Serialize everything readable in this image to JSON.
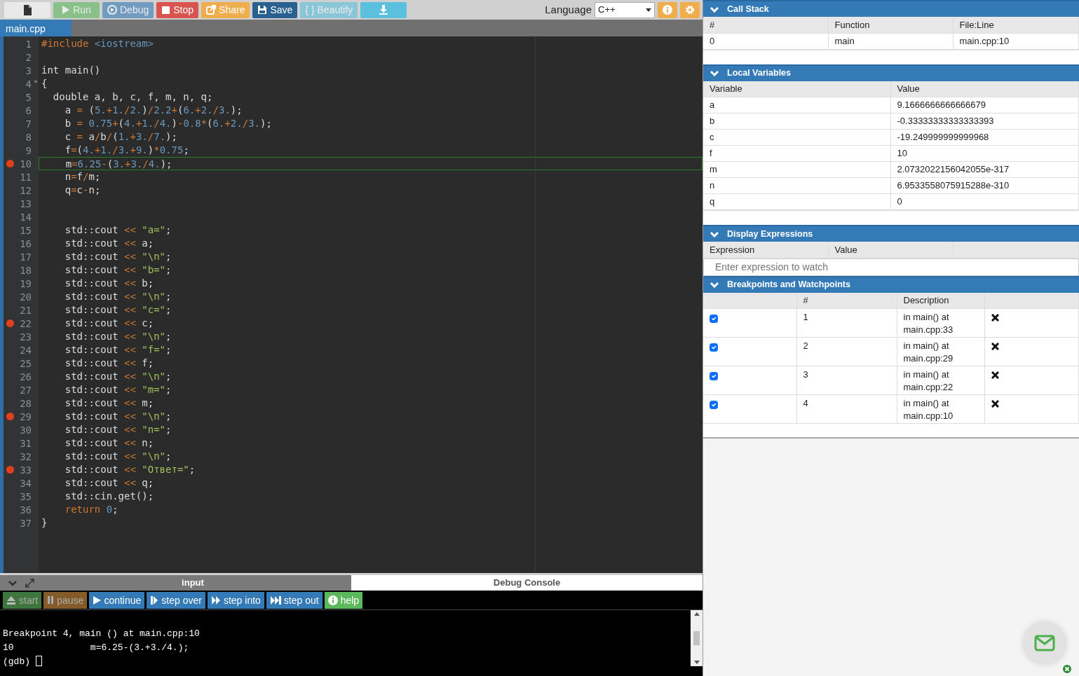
{
  "toolbar": {
    "buttons": [
      {
        "kind": "new",
        "disabled": false
      },
      {
        "kind": "run",
        "label": "Run",
        "disabled": true
      },
      {
        "kind": "debug",
        "label": "Debug",
        "disabled": true
      },
      {
        "kind": "stop",
        "label": "Stop",
        "disabled": false
      },
      {
        "kind": "share",
        "label": "Share",
        "disabled": false
      },
      {
        "kind": "save",
        "label": "Save",
        "disabled": false
      },
      {
        "kind": "beautify",
        "label": "{ } Beautify",
        "disabled": true
      },
      {
        "kind": "download",
        "disabled": false
      }
    ],
    "language_label": "Language",
    "language": "C++",
    "icon_buttons": [
      {
        "kind": "info"
      },
      {
        "kind": "settings"
      }
    ]
  },
  "file_tabs": [
    {
      "label": "main.cpp",
      "selected": true
    }
  ],
  "editor": {
    "lines": [
      {
        "number": "1",
        "breakpoint": false,
        "current": false,
        "fold": false,
        "tokens": [
          {
            "kind": "kw",
            "text": "#include"
          },
          {
            "kind": "num",
            "text": " <iostream>"
          }
        ]
      },
      {
        "number": "2",
        "breakpoint": false,
        "current": false,
        "fold": false
      },
      {
        "number": "3",
        "breakpoint": false,
        "current": false,
        "fold": false,
        "tokens": [
          {
            "kind": "txt",
            "text": "int main()"
          }
        ]
      },
      {
        "number": "4",
        "breakpoint": false,
        "current": false,
        "fold": true,
        "tokens": [
          {
            "kind": "txt",
            "text": "{"
          }
        ]
      },
      {
        "number": "5",
        "breakpoint": false,
        "current": false,
        "fold": false,
        "tokens": [
          {
            "kind": "txt",
            "text": "  double a, b, c, f, m, n, q;"
          }
        ]
      },
      {
        "number": "6",
        "breakpoint": false,
        "current": false,
        "fold": false,
        "tokens": [
          {
            "kind": "txt",
            "text": "    a "
          },
          {
            "kind": "op",
            "text": "="
          },
          {
            "kind": "txt",
            "text": " ("
          },
          {
            "kind": "num",
            "text": "5."
          },
          {
            "kind": "op",
            "text": "+"
          },
          {
            "kind": "num",
            "text": "1."
          },
          {
            "kind": "op",
            "text": "/"
          },
          {
            "kind": "num",
            "text": "2."
          },
          {
            "kind": "txt",
            "text": ")"
          },
          {
            "kind": "op",
            "text": "/"
          },
          {
            "kind": "num",
            "text": "2.2"
          },
          {
            "kind": "op",
            "text": "+"
          },
          {
            "kind": "txt",
            "text": "("
          },
          {
            "kind": "num",
            "text": "6."
          },
          {
            "kind": "op",
            "text": "+"
          },
          {
            "kind": "num",
            "text": "2."
          },
          {
            "kind": "op",
            "text": "/"
          },
          {
            "kind": "num",
            "text": "3."
          },
          {
            "kind": "txt",
            "text": ");"
          }
        ]
      },
      {
        "number": "7",
        "breakpoint": false,
        "current": false,
        "fold": false,
        "tokens": [
          {
            "kind": "txt",
            "text": "    b "
          },
          {
            "kind": "op",
            "text": "="
          },
          {
            "kind": "num",
            "text": " 0.75"
          },
          {
            "kind": "op",
            "text": "+"
          },
          {
            "kind": "txt",
            "text": "("
          },
          {
            "kind": "num",
            "text": "4."
          },
          {
            "kind": "op",
            "text": "+"
          },
          {
            "kind": "num",
            "text": "1."
          },
          {
            "kind": "op",
            "text": "/"
          },
          {
            "kind": "num",
            "text": "4."
          },
          {
            "kind": "txt",
            "text": ")"
          },
          {
            "kind": "op",
            "text": "-"
          },
          {
            "kind": "num",
            "text": "0.8"
          },
          {
            "kind": "op",
            "text": "*"
          },
          {
            "kind": "txt",
            "text": "("
          },
          {
            "kind": "num",
            "text": "6."
          },
          {
            "kind": "op",
            "text": "+"
          },
          {
            "kind": "num",
            "text": "2."
          },
          {
            "kind": "op",
            "text": "/"
          },
          {
            "kind": "num",
            "text": "3."
          },
          {
            "kind": "txt",
            "text": ");"
          }
        ]
      },
      {
        "number": "8",
        "breakpoint": false,
        "current": false,
        "fold": false,
        "tokens": [
          {
            "kind": "txt",
            "text": "    c "
          },
          {
            "kind": "op",
            "text": "="
          },
          {
            "kind": "txt",
            "text": " a"
          },
          {
            "kind": "op",
            "text": "/"
          },
          {
            "kind": "txt",
            "text": "b"
          },
          {
            "kind": "op",
            "text": "/"
          },
          {
            "kind": "txt",
            "text": "("
          },
          {
            "kind": "num",
            "text": "1."
          },
          {
            "kind": "op",
            "text": "+"
          },
          {
            "kind": "num",
            "text": "3."
          },
          {
            "kind": "op",
            "text": "/"
          },
          {
            "kind": "num",
            "text": "7."
          },
          {
            "kind": "txt",
            "text": ");"
          }
        ]
      },
      {
        "number": "9",
        "breakpoint": false,
        "current": false,
        "fold": false,
        "tokens": [
          {
            "kind": "txt",
            "text": "    f"
          },
          {
            "kind": "op",
            "text": "="
          },
          {
            "kind": "txt",
            "text": "("
          },
          {
            "kind": "num",
            "text": "4."
          },
          {
            "kind": "op",
            "text": "+"
          },
          {
            "kind": "num",
            "text": "1."
          },
          {
            "kind": "op",
            "text": "/"
          },
          {
            "kind": "num",
            "text": "3."
          },
          {
            "kind": "op",
            "text": "+"
          },
          {
            "kind": "num",
            "text": "9."
          },
          {
            "kind": "txt",
            "text": ")"
          },
          {
            "kind": "op",
            "text": "*"
          },
          {
            "kind": "num",
            "text": "0.75"
          },
          {
            "kind": "txt",
            "text": ";"
          }
        ]
      },
      {
        "number": "10",
        "breakpoint": true,
        "current": true,
        "fold": false,
        "tokens": [
          {
            "kind": "txt",
            "text": "    m"
          },
          {
            "kind": "op",
            "text": "="
          },
          {
            "kind": "num",
            "text": "6.25"
          },
          {
            "kind": "op",
            "text": "-"
          },
          {
            "kind": "txt",
            "text": "("
          },
          {
            "kind": "num",
            "text": "3."
          },
          {
            "kind": "op",
            "text": "+"
          },
          {
            "kind": "num",
            "text": "3."
          },
          {
            "kind": "op",
            "text": "/"
          },
          {
            "kind": "num",
            "text": "4."
          },
          {
            "kind": "txt",
            "text": ");"
          }
        ]
      },
      {
        "number": "11",
        "breakpoint": false,
        "current": false,
        "fold": false,
        "tokens": [
          {
            "kind": "txt",
            "text": "    n"
          },
          {
            "kind": "op",
            "text": "="
          },
          {
            "kind": "txt",
            "text": "f"
          },
          {
            "kind": "op",
            "text": "/"
          },
          {
            "kind": "txt",
            "text": "m;"
          }
        ]
      },
      {
        "number": "12",
        "breakpoint": false,
        "current": false,
        "fold": false,
        "tokens": [
          {
            "kind": "txt",
            "text": "    q"
          },
          {
            "kind": "op",
            "text": "="
          },
          {
            "kind": "txt",
            "text": "c"
          },
          {
            "kind": "op",
            "text": "-"
          },
          {
            "kind": "txt",
            "text": "n;"
          }
        ]
      },
      {
        "number": "13",
        "breakpoint": false,
        "current": false,
        "fold": false
      },
      {
        "number": "14",
        "breakpoint": false,
        "current": false,
        "fold": false
      },
      {
        "number": "15",
        "breakpoint": false,
        "current": false,
        "fold": false,
        "tokens": [
          {
            "kind": "txt",
            "text": "    std::cout "
          },
          {
            "kind": "op",
            "text": "<<"
          },
          {
            "kind": "str",
            "text": " \"a=\""
          },
          {
            "kind": "txt",
            "text": ";"
          }
        ]
      },
      {
        "number": "16",
        "breakpoint": false,
        "current": false,
        "fold": false,
        "tokens": [
          {
            "kind": "txt",
            "text": "    std::cout "
          },
          {
            "kind": "op",
            "text": "<<"
          },
          {
            "kind": "txt",
            "text": " a;"
          }
        ]
      },
      {
        "number": "17",
        "breakpoint": false,
        "current": false,
        "fold": false,
        "tokens": [
          {
            "kind": "txt",
            "text": "    std::cout "
          },
          {
            "kind": "op",
            "text": "<<"
          },
          {
            "kind": "str",
            "text": " \"\\n\""
          },
          {
            "kind": "txt",
            "text": ";"
          }
        ]
      },
      {
        "number": "18",
        "breakpoint": false,
        "current": false,
        "fold": false,
        "tokens": [
          {
            "kind": "txt",
            "text": "    std::cout "
          },
          {
            "kind": "op",
            "text": "<<"
          },
          {
            "kind": "str",
            "text": " \"b=\""
          },
          {
            "kind": "txt",
            "text": ";"
          }
        ]
      },
      {
        "number": "19",
        "breakpoint": false,
        "current": false,
        "fold": false,
        "tokens": [
          {
            "kind": "txt",
            "text": "    std::cout "
          },
          {
            "kind": "op",
            "text": "<<"
          },
          {
            "kind": "txt",
            "text": " b;"
          }
        ]
      },
      {
        "number": "20",
        "breakpoint": false,
        "current": false,
        "fold": false,
        "tokens": [
          {
            "kind": "txt",
            "text": "    std::cout "
          },
          {
            "kind": "op",
            "text": "<<"
          },
          {
            "kind": "str",
            "text": " \"\\n\""
          },
          {
            "kind": "txt",
            "text": ";"
          }
        ]
      },
      {
        "number": "21",
        "breakpoint": false,
        "current": false,
        "fold": false,
        "tokens": [
          {
            "kind": "txt",
            "text": "    std::cout "
          },
          {
            "kind": "op",
            "text": "<<"
          },
          {
            "kind": "str",
            "text": " \"c=\""
          },
          {
            "kind": "txt",
            "text": ";"
          }
        ]
      },
      {
        "number": "22",
        "breakpoint": true,
        "current": false,
        "fold": false,
        "tokens": [
          {
            "kind": "txt",
            "text": "    std::cout "
          },
          {
            "kind": "op",
            "text": "<<"
          },
          {
            "kind": "txt",
            "text": " c;"
          }
        ]
      },
      {
        "number": "23",
        "breakpoint": false,
        "current": false,
        "fold": false,
        "tokens": [
          {
            "kind": "txt",
            "text": "    std::cout "
          },
          {
            "kind": "op",
            "text": "<<"
          },
          {
            "kind": "str",
            "text": " \"\\n\""
          },
          {
            "kind": "txt",
            "text": ";"
          }
        ]
      },
      {
        "number": "24",
        "breakpoint": false,
        "current": false,
        "fold": false,
        "tokens": [
          {
            "kind": "txt",
            "text": "    std::cout "
          },
          {
            "kind": "op",
            "text": "<<"
          },
          {
            "kind": "str",
            "text": " \"f=\""
          },
          {
            "kind": "txt",
            "text": ";"
          }
        ]
      },
      {
        "number": "25",
        "breakpoint": false,
        "current": false,
        "fold": false,
        "tokens": [
          {
            "kind": "txt",
            "text": "    std::cout "
          },
          {
            "kind": "op",
            "text": "<<"
          },
          {
            "kind": "txt",
            "text": " f;"
          }
        ]
      },
      {
        "number": "26",
        "breakpoint": false,
        "current": false,
        "fold": false,
        "tokens": [
          {
            "kind": "txt",
            "text": "    std::cout "
          },
          {
            "kind": "op",
            "text": "<<"
          },
          {
            "kind": "str",
            "text": " \"\\n\""
          },
          {
            "kind": "txt",
            "text": ";"
          }
        ]
      },
      {
        "number": "27",
        "breakpoint": false,
        "current": false,
        "fold": false,
        "tokens": [
          {
            "kind": "txt",
            "text": "    std::cout "
          },
          {
            "kind": "op",
            "text": "<<"
          },
          {
            "kind": "str",
            "text": " \"m=\""
          },
          {
            "kind": "txt",
            "text": ";"
          }
        ]
      },
      {
        "number": "28",
        "breakpoint": false,
        "current": false,
        "fold": false,
        "tokens": [
          {
            "kind": "txt",
            "text": "    std::cout "
          },
          {
            "kind": "op",
            "text": "<<"
          },
          {
            "kind": "txt",
            "text": " m;"
          }
        ]
      },
      {
        "number": "29",
        "breakpoint": true,
        "current": false,
        "fold": false,
        "tokens": [
          {
            "kind": "txt",
            "text": "    std::cout "
          },
          {
            "kind": "op",
            "text": "<<"
          },
          {
            "kind": "str",
            "text": " \"\\n\""
          },
          {
            "kind": "txt",
            "text": ";"
          }
        ]
      },
      {
        "number": "30",
        "breakpoint": false,
        "current": false,
        "fold": false,
        "tokens": [
          {
            "kind": "txt",
            "text": "    std::cout "
          },
          {
            "kind": "op",
            "text": "<<"
          },
          {
            "kind": "str",
            "text": " \"n=\""
          },
          {
            "kind": "txt",
            "text": ";"
          }
        ]
      },
      {
        "number": "31",
        "breakpoint": false,
        "current": false,
        "fold": false,
        "tokens": [
          {
            "kind": "txt",
            "text": "    std::cout "
          },
          {
            "kind": "op",
            "text": "<<"
          },
          {
            "kind": "txt",
            "text": " n;"
          }
        ]
      },
      {
        "number": "32",
        "breakpoint": false,
        "current": false,
        "fold": false,
        "tokens": [
          {
            "kind": "txt",
            "text": "    std::cout "
          },
          {
            "kind": "op",
            "text": "<<"
          },
          {
            "kind": "str",
            "text": " \"\\n\""
          },
          {
            "kind": "txt",
            "text": ";"
          }
        ]
      },
      {
        "number": "33",
        "breakpoint": true,
        "current": false,
        "fold": false,
        "tokens": [
          {
            "kind": "txt",
            "text": "    std::cout "
          },
          {
            "kind": "op",
            "text": "<<"
          },
          {
            "kind": "str",
            "text": " \"Ответ=\""
          },
          {
            "kind": "txt",
            "text": ";"
          }
        ]
      },
      {
        "number": "34",
        "breakpoint": false,
        "current": false,
        "fold": false,
        "tokens": [
          {
            "kind": "txt",
            "text": "    std::cout "
          },
          {
            "kind": "op",
            "text": "<<"
          },
          {
            "kind": "txt",
            "text": " q;"
          }
        ]
      },
      {
        "number": "35",
        "breakpoint": false,
        "current": false,
        "fold": false,
        "tokens": [
          {
            "kind": "txt",
            "text": "    std::cin.get();"
          }
        ]
      },
      {
        "number": "36",
        "breakpoint": false,
        "current": false,
        "fold": false,
        "tokens": [
          {
            "kind": "kw",
            "text": "    return"
          },
          {
            "kind": "num",
            "text": " 0"
          },
          {
            "kind": "txt",
            "text": ";"
          }
        ]
      },
      {
        "number": "37",
        "breakpoint": false,
        "current": false,
        "fold": false,
        "tokens": [
          {
            "kind": "txt",
            "text": "}"
          }
        ]
      }
    ]
  },
  "bottom_tabs": [
    {
      "label": "input",
      "selected": false
    },
    {
      "label": "Debug Console",
      "selected": true
    }
  ],
  "debug_buttons": [
    {
      "kind": "start",
      "label": "start",
      "disabled": true
    },
    {
      "kind": "pause",
      "label": "pause",
      "disabled": true
    },
    {
      "kind": "continue",
      "label": "continue",
      "disabled": false
    },
    {
      "kind": "step_over",
      "label": "step over",
      "disabled": false
    },
    {
      "kind": "step_into",
      "label": "step into",
      "disabled": false
    },
    {
      "kind": "step_out",
      "label": "step out",
      "disabled": false
    },
    {
      "kind": "help",
      "label": "help",
      "disabled": false
    }
  ],
  "console": {
    "lines": [
      "Breakpoint 4, main () at main.cpp:10",
      "10\t\tm=6.25-(3.+3./4.);"
    ],
    "prompt": "(gdb)"
  },
  "call_stack": {
    "title": "Call Stack",
    "columns": [
      "#",
      "Function",
      "File:Line"
    ],
    "rows": [
      [
        "0",
        "main",
        "main.cpp:10"
      ]
    ]
  },
  "local_variables": {
    "title": "Local Variables",
    "columns": [
      "Variable",
      "Value"
    ],
    "rows": [
      [
        "a",
        "9.1666666666666679"
      ],
      [
        "b",
        "-0.33333333333333393"
      ],
      [
        "c",
        "-19.249999999999968"
      ],
      [
        "f",
        "10"
      ],
      [
        "m",
        "2.0732022156042055e-317"
      ],
      [
        "n",
        "6.9533558075915288e-310"
      ],
      [
        "q",
        "0"
      ]
    ]
  },
  "display_expressions": {
    "title": "Display Expressions",
    "columns": [
      "Expression",
      "Value"
    ],
    "placeholder": "Enter expression to watch"
  },
  "breakpoints": {
    "title": "Breakpoints and Watchpoints",
    "columns": [
      "#",
      "Description"
    ],
    "rows": [
      {
        "enabled": true,
        "number": "1",
        "description": "in main() at main.cpp:33"
      },
      {
        "enabled": true,
        "number": "2",
        "description": "in main() at main.cpp:29"
      },
      {
        "enabled": true,
        "number": "3",
        "description": "in main() at main.cpp:22"
      },
      {
        "enabled": true,
        "number": "4",
        "description": "in main() at main.cpp:10"
      }
    ]
  }
}
